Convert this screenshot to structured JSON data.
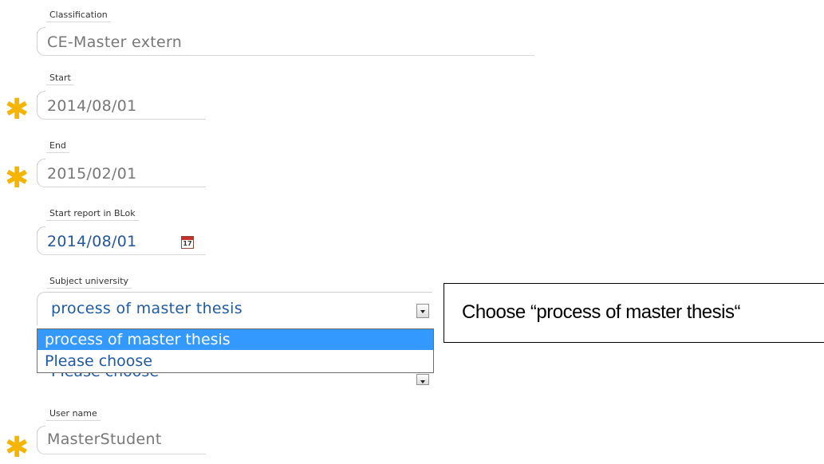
{
  "classification": {
    "label": "Classification",
    "value": "CE-Master extern"
  },
  "start": {
    "label": "Start",
    "value": "2014/08/01"
  },
  "end": {
    "label": "End",
    "value": "2015/02/01"
  },
  "start_report": {
    "label": "Start report in BLok",
    "value": "2014/08/01",
    "calendar_day": "17"
  },
  "subject_university": {
    "label": "Subject university",
    "selected": "process of master thesis",
    "options": [
      "process of master thesis",
      "Please choose"
    ],
    "second_select_value": "Please choose"
  },
  "user_name": {
    "label": "User name",
    "value": "MasterStudent"
  },
  "callout": {
    "text": "Choose “process of master thesis“"
  },
  "required_marker": "✱",
  "icons": {
    "required": "asterisk-icon",
    "calendar": "calendar-icon",
    "dropdown": "chevron-down-icon"
  },
  "colors": {
    "required": "#f5b400",
    "highlight": "#3399ff",
    "value_blue": "#23569b",
    "value_gray": "#777777"
  }
}
